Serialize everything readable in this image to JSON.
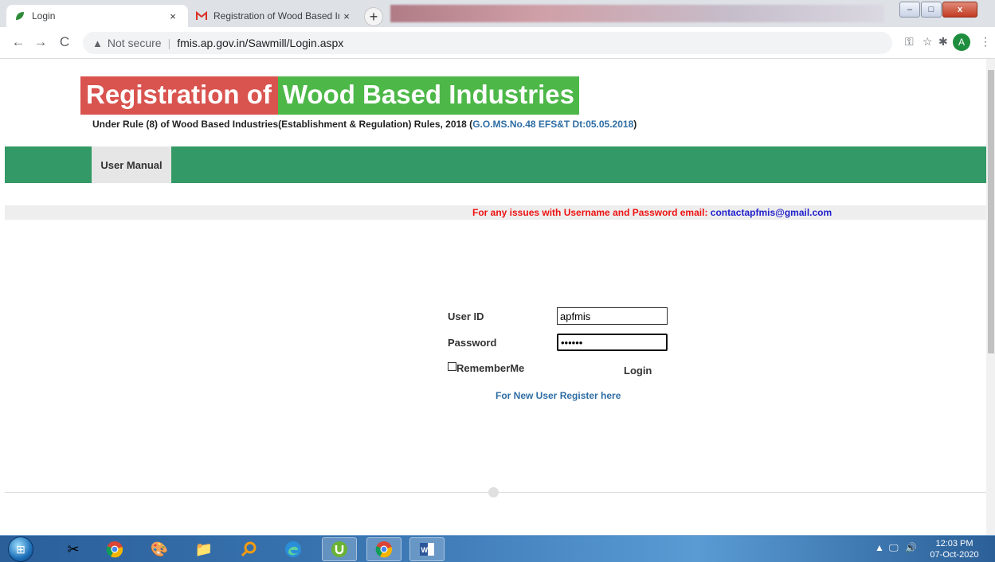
{
  "browser": {
    "tabs": [
      {
        "title": "Login",
        "close": "×"
      },
      {
        "title": "Registration of Wood Based Indu",
        "close": "×"
      }
    ],
    "new_tab": "+",
    "window_controls": {
      "minimize": "–",
      "maximize": "□",
      "close": "x"
    },
    "nav": {
      "back": "←",
      "forward": "→",
      "reload": "C"
    },
    "address": {
      "security_label": "Not secure",
      "url": "fmis.ap.gov.in/Sawmill/Login.aspx"
    },
    "profile_initial": "A"
  },
  "header": {
    "title_part1": "Registration of",
    "title_part2": "Wood Based Industries",
    "subtitle": "Under Rule (8) of Wood Based Industries(Establishment & Regulation) Rules, 2018 (",
    "subtitle_link": "G.O.MS.No.48 EFS&T Dt:05.05.2018",
    "subtitle_end": ")"
  },
  "nav": {
    "user_manual": "User Manual"
  },
  "notice": {
    "text": "For any issues with Username and Password email: ",
    "email": "contactapfmis@gmail.com"
  },
  "login_form": {
    "user_id_label": "User ID",
    "user_id_value": "apfmis",
    "password_label": "Password",
    "password_value": "••••••",
    "remember_label": "RememberMe",
    "login_button": "Login",
    "register_link": "For New User Register here"
  },
  "taskbar": {
    "time": "12:03 PM",
    "date": "07-Oct-2020"
  },
  "colors": {
    "title_red": "#d9534f",
    "title_green": "#4db848",
    "nav_green": "#339966",
    "notice_red": "#ee1111",
    "link_blue": "#2e6da4"
  }
}
